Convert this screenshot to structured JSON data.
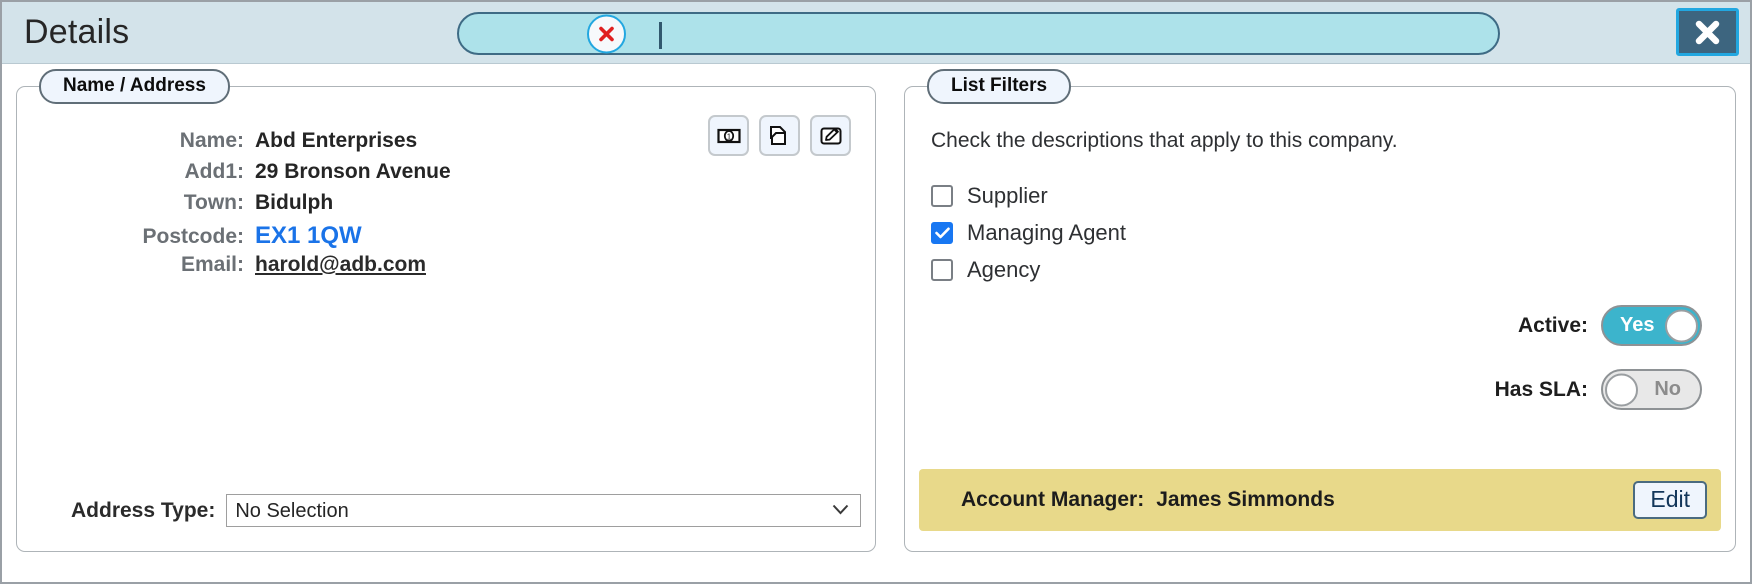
{
  "header": {
    "title": "Details",
    "search": {
      "value": "",
      "placeholder": "",
      "clear_icon": "clear-x-icon"
    },
    "close_label": "close-x-icon"
  },
  "name_address": {
    "legend": "Name / Address",
    "rows": [
      {
        "label": "Name:",
        "value": "Abd Enterprises",
        "style": "plain"
      },
      {
        "label": "Add1:",
        "value": "29 Bronson Avenue",
        "style": "plain"
      },
      {
        "label": "Town:",
        "value": "Bidulph",
        "style": "plain"
      },
      {
        "label": "Postcode:",
        "value": "EX1 1QW",
        "style": "link-blue"
      },
      {
        "label": "Email:",
        "value": "harold@adb.com",
        "style": "link-mail"
      }
    ],
    "icon_buttons": [
      {
        "name": "banknote-icon",
        "title": "Banknote"
      },
      {
        "name": "copy-icon",
        "title": "Copy"
      },
      {
        "name": "edit-pencil-icon",
        "title": "Edit"
      }
    ],
    "address_type": {
      "label": "Address Type:",
      "selected": "No Selection",
      "options": [
        "No Selection"
      ]
    }
  },
  "list_filters": {
    "legend": "List Filters",
    "hint": "Check the descriptions that apply to this company.",
    "checkboxes": [
      {
        "label": "Supplier",
        "checked": false
      },
      {
        "label": "Managing Agent",
        "checked": true
      },
      {
        "label": "Agency",
        "checked": false
      }
    ],
    "toggles": [
      {
        "label": "Active:",
        "state": "Yes",
        "on": true
      },
      {
        "label": "Has SLA:",
        "state": "No",
        "on": false
      }
    ],
    "account_manager": {
      "label": "Account Manager:",
      "value": "James Simmonds",
      "edit_label": "Edit"
    }
  },
  "colors": {
    "header_bg": "#d3e3ea",
    "search_bg": "#ade2ea",
    "accent_blue": "#1a73e8",
    "checkbox_checked": "#1877f2",
    "toggle_on": "#3cb4cc",
    "account_bar": "#e8d98a",
    "close_btn": "#3d657f"
  }
}
